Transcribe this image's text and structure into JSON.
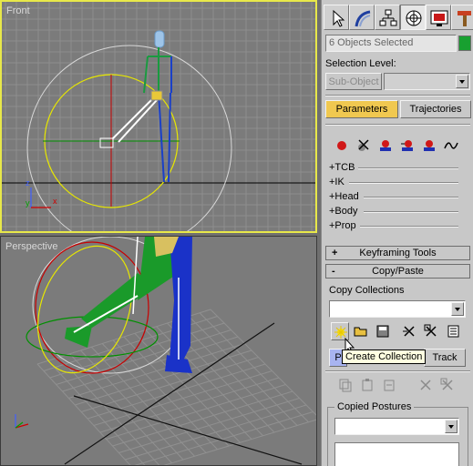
{
  "viewports": {
    "front": {
      "label": "Front"
    },
    "perspective": {
      "label": "Perspective"
    }
  },
  "axis": {
    "x": "x",
    "y": "y",
    "z": "z"
  },
  "command_panel": {
    "tabs": [
      {
        "name": "create",
        "icon": "cursor-icon"
      },
      {
        "name": "modify",
        "icon": "bend-icon"
      },
      {
        "name": "hierarchy",
        "icon": "hierarchy-icon"
      },
      {
        "name": "motion",
        "icon": "motion-icon"
      },
      {
        "name": "display",
        "icon": "display-icon"
      },
      {
        "name": "utilities",
        "icon": "hammer-icon"
      }
    ],
    "selection_field": "6 Objects Selected",
    "selection_color": "#18a030",
    "selection_level_label": "Selection Level:",
    "sub_object_label": "Sub-Object",
    "parameters_label": "Parameters",
    "trajectories_label": "Trajectories",
    "tracks": [
      "+TCB",
      "+IK",
      "+Head",
      "+Body",
      "+Prop"
    ],
    "rollouts": {
      "keyframing_sign": "+",
      "keyframing": "Keyframing Tools",
      "copypaste_sign": "-",
      "copypaste": "Copy/Paste"
    },
    "copy_collections_label": "Copy Collections",
    "posture_button": "P",
    "track_button": "Track",
    "copied_postures_label": "Copied Postures",
    "tooltip": "Create Collection"
  }
}
